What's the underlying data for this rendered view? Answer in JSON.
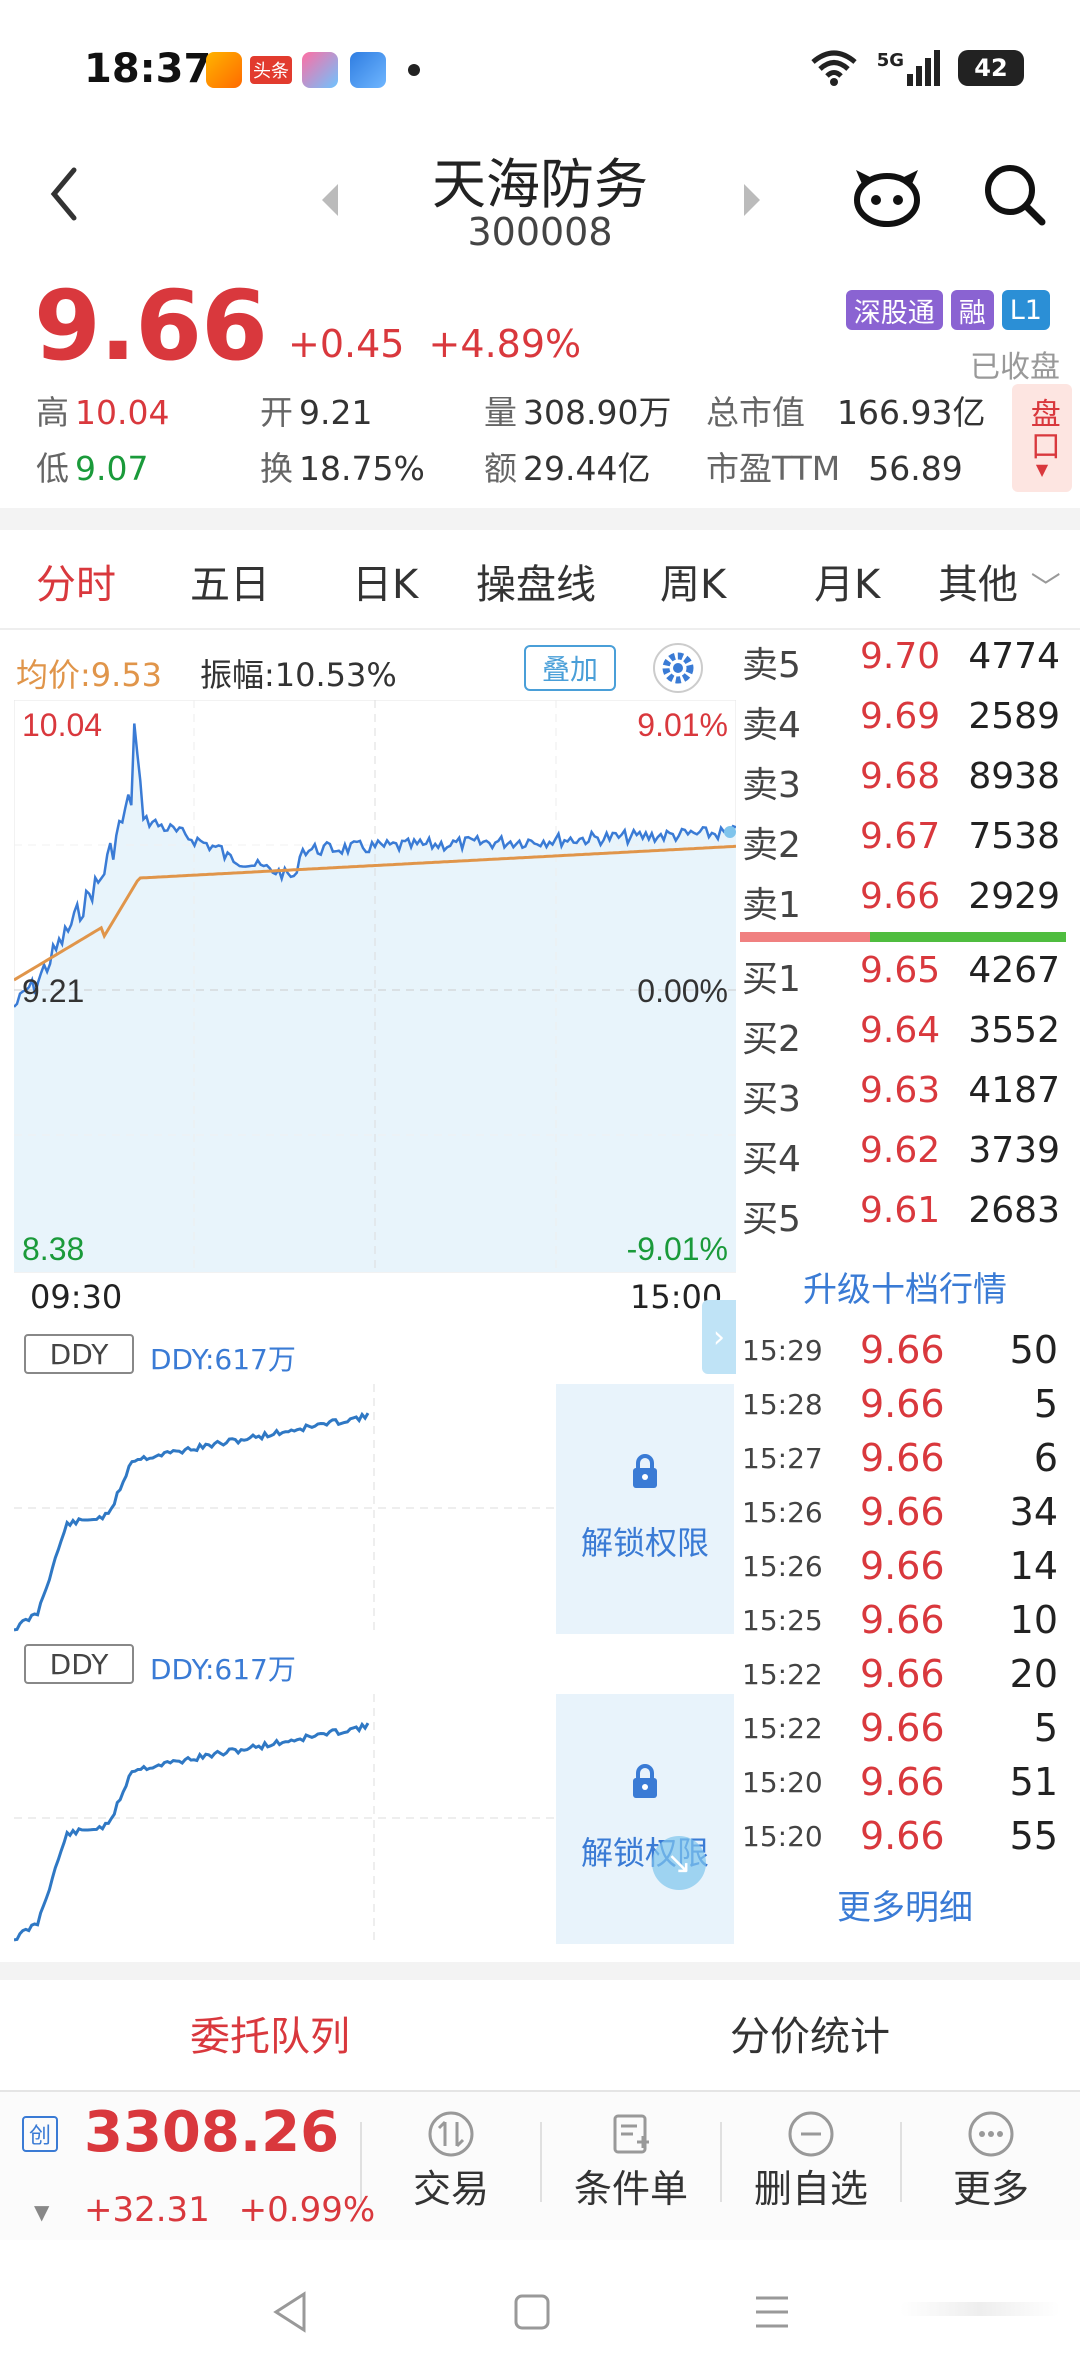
{
  "status_bar": {
    "time": "18:37",
    "app_news_label": "头条",
    "network": "5G",
    "battery": "42"
  },
  "header": {
    "name": "天海防务",
    "code": "300008"
  },
  "quote": {
    "price": "9.66",
    "change": "+0.45",
    "change_pct": "+4.89%",
    "badges": [
      {
        "label": "深股通",
        "color": "#8a63d2"
      },
      {
        "label": "融",
        "color": "#8a63d2"
      },
      {
        "label": "L1",
        "color": "#2b8fd6"
      }
    ],
    "status": "已收盘",
    "high_label": "高",
    "high": "10.04",
    "low_label": "低",
    "low": "9.07",
    "open_label": "开",
    "open": "9.21",
    "turnover_label": "换",
    "turnover": "18.75%",
    "volume_label": "量",
    "volume": "308.90万",
    "amount_label": "额",
    "amount": "29.44亿",
    "mcap_label": "总市值",
    "mcap": "166.93亿",
    "pe_label": "市盈TTM",
    "pe": "56.89",
    "pankou_label": "盘口"
  },
  "tabs": [
    "分时",
    "五日",
    "日K",
    "操盘线",
    "周K",
    "月K",
    "其他"
  ],
  "active_tab": 0,
  "chart": {
    "avg_label": "均价:9.53",
    "amplitude_label": "振幅:10.53%",
    "overlay_label": "叠加",
    "y_top": "10.04",
    "y_top_pct": "9.01%",
    "y_mid": "9.21",
    "y_mid_pct": "0.00%",
    "y_bottom": "8.38",
    "y_bottom_pct": "-9.01%",
    "x_start": "09:30",
    "x_end": "15:00",
    "price_color": "#3a7bd5",
    "avg_color": "#e0954a"
  },
  "ddy_panels": [
    {
      "button": "DDY",
      "value": "DDY:617万",
      "lock_label": "解锁权限"
    },
    {
      "button": "DDY",
      "value": "DDY:617万",
      "lock_label": "解锁权限"
    }
  ],
  "order_book": {
    "asks": [
      {
        "label": "卖5",
        "price": "9.70",
        "volume": "4774"
      },
      {
        "label": "卖4",
        "price": "9.69",
        "volume": "2589"
      },
      {
        "label": "卖3",
        "price": "9.68",
        "volume": "8938"
      },
      {
        "label": "卖2",
        "price": "9.67",
        "volume": "7538"
      },
      {
        "label": "卖1",
        "price": "9.66",
        "volume": "2929"
      }
    ],
    "bids": [
      {
        "label": "买1",
        "price": "9.65",
        "volume": "4267"
      },
      {
        "label": "买2",
        "price": "9.64",
        "volume": "3552"
      },
      {
        "label": "买3",
        "price": "9.63",
        "volume": "4187"
      },
      {
        "label": "买4",
        "price": "9.62",
        "volume": "3739"
      },
      {
        "label": "买5",
        "price": "9.61",
        "volume": "2683"
      }
    ],
    "upgrade_label": "升级十档行情"
  },
  "ticks": [
    {
      "time": "15:29",
      "price": "9.66",
      "volume": "50"
    },
    {
      "time": "15:28",
      "price": "9.66",
      "volume": "5"
    },
    {
      "time": "15:27",
      "price": "9.66",
      "volume": "6"
    },
    {
      "time": "15:26",
      "price": "9.66",
      "volume": "34"
    },
    {
      "time": "15:26",
      "price": "9.66",
      "volume": "14"
    },
    {
      "time": "15:25",
      "price": "9.66",
      "volume": "10"
    },
    {
      "time": "15:22",
      "price": "9.66",
      "volume": "20"
    },
    {
      "time": "15:22",
      "price": "9.66",
      "volume": "5"
    },
    {
      "time": "15:20",
      "price": "9.66",
      "volume": "51"
    },
    {
      "time": "15:20",
      "price": "9.66",
      "volume": "55"
    }
  ],
  "more_detail_label": "更多明细",
  "bottom_tabs": {
    "queue": "委托队列",
    "price_stats": "分价统计"
  },
  "index_bar": {
    "icon": "创",
    "value": "3308.26",
    "change": "+32.31",
    "change_pct": "+0.99%"
  },
  "toolbar": [
    {
      "label": "交易",
      "icon": "trade-icon"
    },
    {
      "label": "条件单",
      "icon": "condition-order-icon"
    },
    {
      "label": "删自选",
      "icon": "remove-watchlist-icon"
    },
    {
      "label": "更多",
      "icon": "more-icon"
    }
  ]
}
